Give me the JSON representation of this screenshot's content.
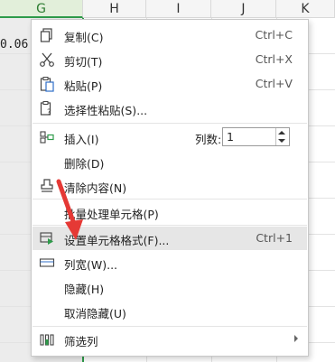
{
  "columns": [
    "G",
    "H",
    "I",
    "J",
    "K"
  ],
  "cell_value": "0.06",
  "menu": {
    "copy": {
      "label": "复制(C)",
      "shortcut": "Ctrl+C"
    },
    "cut": {
      "label": "剪切(T)",
      "shortcut": "Ctrl+X"
    },
    "paste": {
      "label": "粘贴(P)",
      "shortcut": "Ctrl+V"
    },
    "paste_special": {
      "label": "选择性粘贴(S)..."
    },
    "insert": {
      "label": "插入(I)",
      "cols_label": "列数:",
      "cols_value": "1"
    },
    "delete": {
      "label": "删除(D)"
    },
    "clear": {
      "label": "清除内容(N)"
    },
    "batch": {
      "label": "批量处理单元格(P)"
    },
    "format_cells": {
      "label": "设置单元格格式(F)...",
      "shortcut": "Ctrl+1"
    },
    "col_width": {
      "label": "列宽(W)..."
    },
    "hide": {
      "label": "隐藏(H)"
    },
    "unhide": {
      "label": "取消隐藏(U)"
    },
    "filter": {
      "label": "筛选列"
    }
  },
  "colors": {
    "accent_green": "#2e9b4a",
    "arrow_red": "#e53935",
    "hover_bg": "#e6e6e6"
  }
}
